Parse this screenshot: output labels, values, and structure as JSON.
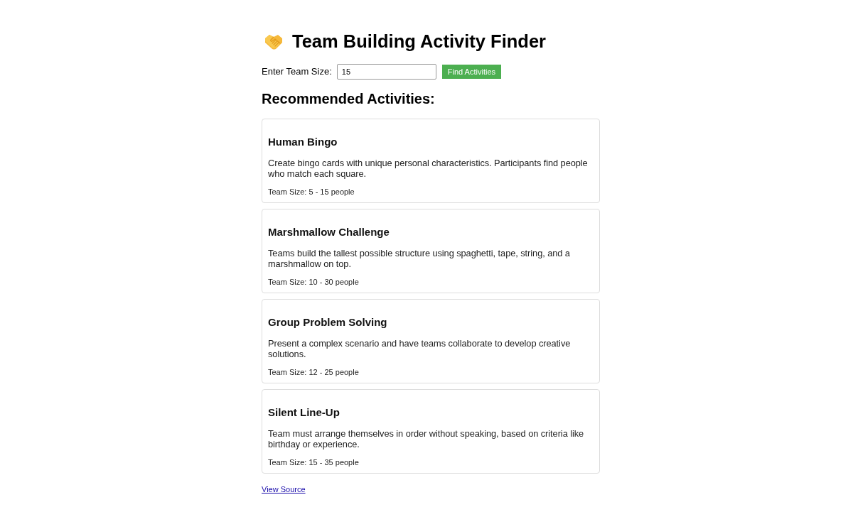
{
  "page": {
    "title": "Team Building Activity Finder"
  },
  "search": {
    "label": "Enter Team Size:",
    "value": "15",
    "button": "Find Activities"
  },
  "results": {
    "heading": "Recommended Activities:",
    "activities": [
      {
        "name": "Human Bingo",
        "description": "Create bingo cards with unique personal characteristics. Participants find people who match each square.",
        "team_size": "Team Size: 5 - 15 people"
      },
      {
        "name": "Marshmallow Challenge",
        "description": "Teams build the tallest possible structure using spaghetti, tape, string, and a marshmallow on top.",
        "team_size": "Team Size: 10 - 30 people"
      },
      {
        "name": "Group Problem Solving",
        "description": "Present a complex scenario and have teams collaborate to develop creative solutions.",
        "team_size": "Team Size: 12 - 25 people"
      },
      {
        "name": "Silent Line-Up",
        "description": "Team must arrange themselves in order without speaking, based on criteria like birthday or experience.",
        "team_size": "Team Size: 15 - 35 people"
      }
    ]
  },
  "footer": {
    "link": "View Source"
  }
}
